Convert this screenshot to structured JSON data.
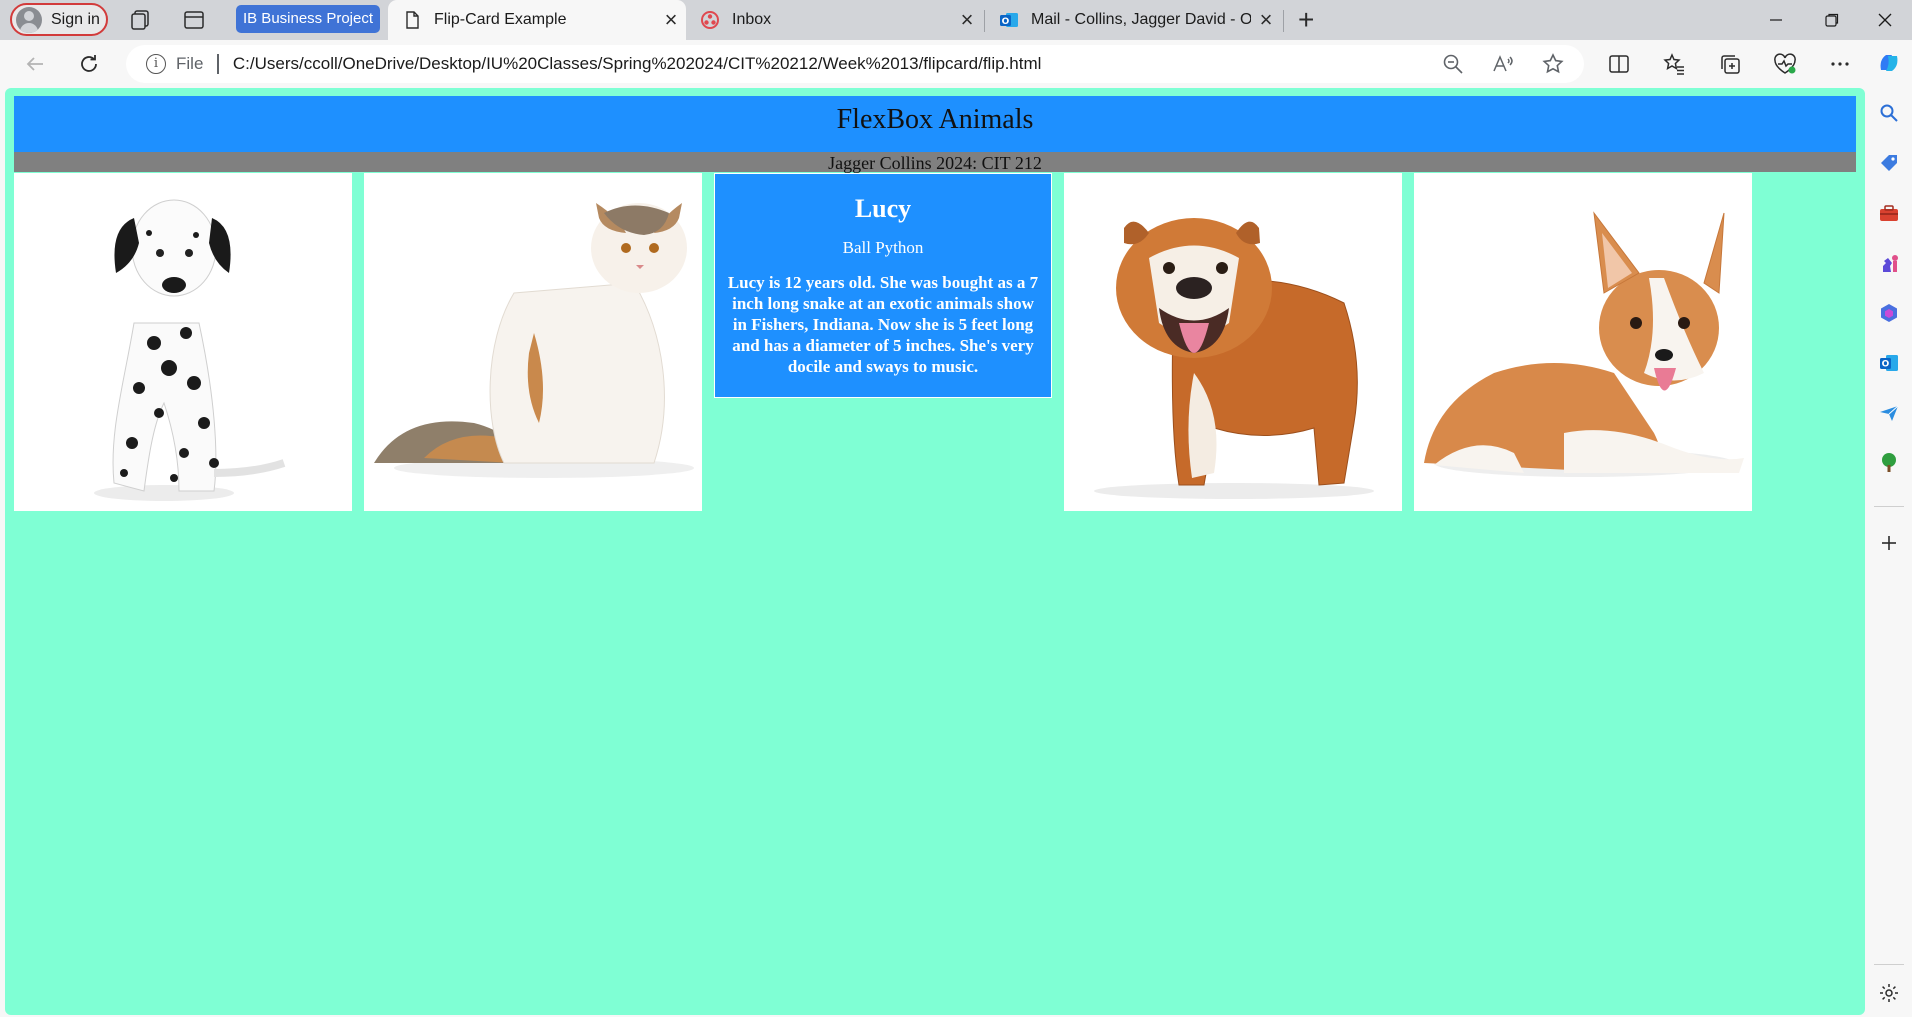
{
  "browser": {
    "sign_in_label": "Sign in",
    "tab_group_label": "IB Business Project",
    "tabs": [
      {
        "title": "Flip-Card Example",
        "icon": "page-icon",
        "active": true
      },
      {
        "title": "Inbox",
        "icon": "asana-icon",
        "active": false
      },
      {
        "title": "Mail - Collins, Jagger David - Out",
        "icon": "outlook-icon",
        "active": false
      }
    ],
    "new_tab_label": "+",
    "window_controls": {
      "minimize": "—",
      "restore": "❐",
      "close": "✕"
    }
  },
  "address_bar": {
    "scheme_label": "File",
    "url": "C:/Users/ccoll/OneDrive/Desktop/IU%20Classes/Spring%202024/CIT%20212/Week%2013/flipcard/flip.html"
  },
  "page": {
    "title": "FlexBox Animals",
    "subtitle": "Jagger Collins 2024: CIT 212",
    "cards": [
      {
        "image": "dalmatian-dog",
        "state": "front"
      },
      {
        "image": "persian-cat",
        "state": "front"
      },
      {
        "state": "back",
        "name": "Lucy",
        "species": "Ball Python",
        "description": "Lucy is 12 years old. She was bought as a 7 inch long snake at an exotic animals show in Fishers, Indiana. Now she is 5 feet long and has a diameter of 5 inches. She's very docile and sways to music."
      },
      {
        "image": "english-bulldog",
        "state": "front"
      },
      {
        "image": "corgi-dog",
        "state": "front"
      }
    ]
  },
  "colors": {
    "page_background": "#7fffd4",
    "header_background": "#1e90ff",
    "subheader_background": "#808080",
    "card_back_background": "#1e90ff",
    "tab_group_color": "#3f73d6"
  }
}
